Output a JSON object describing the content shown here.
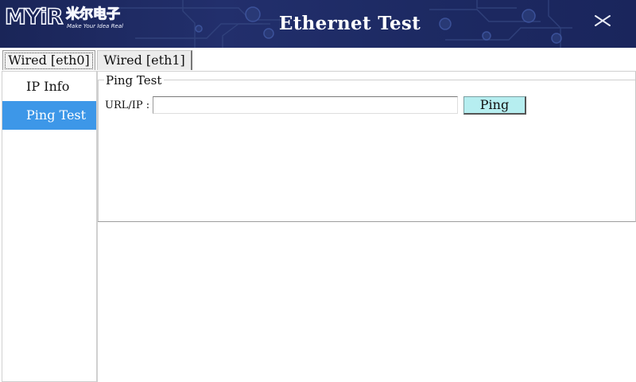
{
  "header": {
    "brand_latin": "MYiR",
    "brand_chinese": "米尔电子",
    "brand_tagline": "Make Your Idea Real",
    "title": "Ethernet Test",
    "close_icon": "close-icon",
    "background_color": "#1d2a63"
  },
  "interface_tabs": [
    {
      "label": "Wired [eth0]",
      "selected": true
    },
    {
      "label": "Wired [eth1]",
      "selected": false
    }
  ],
  "side_menu": {
    "items": [
      {
        "label": "IP Info",
        "selected": false
      },
      {
        "label": "Ping Test",
        "selected": true
      }
    ],
    "selected_color": "#3d97e8"
  },
  "ping_panel": {
    "group_title": "Ping Test",
    "url_label": "URL/IP :",
    "url_value": "",
    "url_placeholder": "",
    "ping_button_label": "Ping",
    "ping_button_color": "#b6eef0"
  }
}
